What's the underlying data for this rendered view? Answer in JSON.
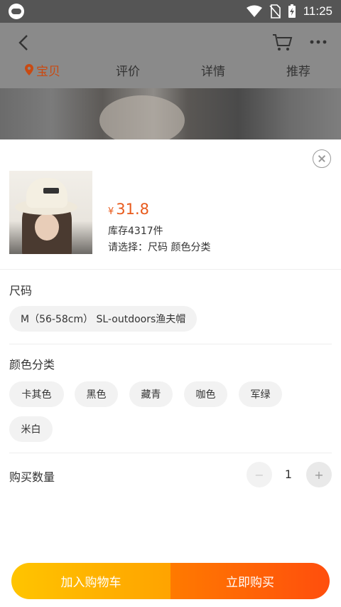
{
  "status_bar": {
    "time": "11:25",
    "icons": [
      "app-notification-icon",
      "wifi-icon",
      "no-sim-icon",
      "battery-charging-icon"
    ]
  },
  "nav": {
    "icons": [
      "back-icon",
      "cart-icon",
      "more-icon"
    ],
    "tabs": [
      {
        "label": "宝贝",
        "active": true
      },
      {
        "label": "评价",
        "active": false
      },
      {
        "label": "详情",
        "active": false
      },
      {
        "label": "推荐",
        "active": false
      }
    ]
  },
  "sheet": {
    "price_symbol": "¥",
    "price": "31.8",
    "stock": "库存4317件",
    "select_hint": "请选择：尺码 颜色分类",
    "size_section": {
      "title": "尺码",
      "options": [
        "M（56-58cm） SL-outdoors渔夫帽"
      ]
    },
    "color_section": {
      "title": "颜色分类",
      "options": [
        "卡其色",
        "黑色",
        "藏青",
        "咖色",
        "军绿",
        "米白"
      ]
    },
    "quantity": {
      "label": "购买数量",
      "minus": "−",
      "value": "1",
      "plus": "+"
    },
    "actions": {
      "add_to_cart": "加入购物车",
      "buy_now": "立即购买"
    }
  },
  "colors": {
    "accent_price": "#e85a1c",
    "active_tab": "#c94a12",
    "cart_gradient": [
      "#ffc400",
      "#ffa300"
    ],
    "buy_gradient": [
      "#ff7a00",
      "#ff4e0d"
    ]
  }
}
